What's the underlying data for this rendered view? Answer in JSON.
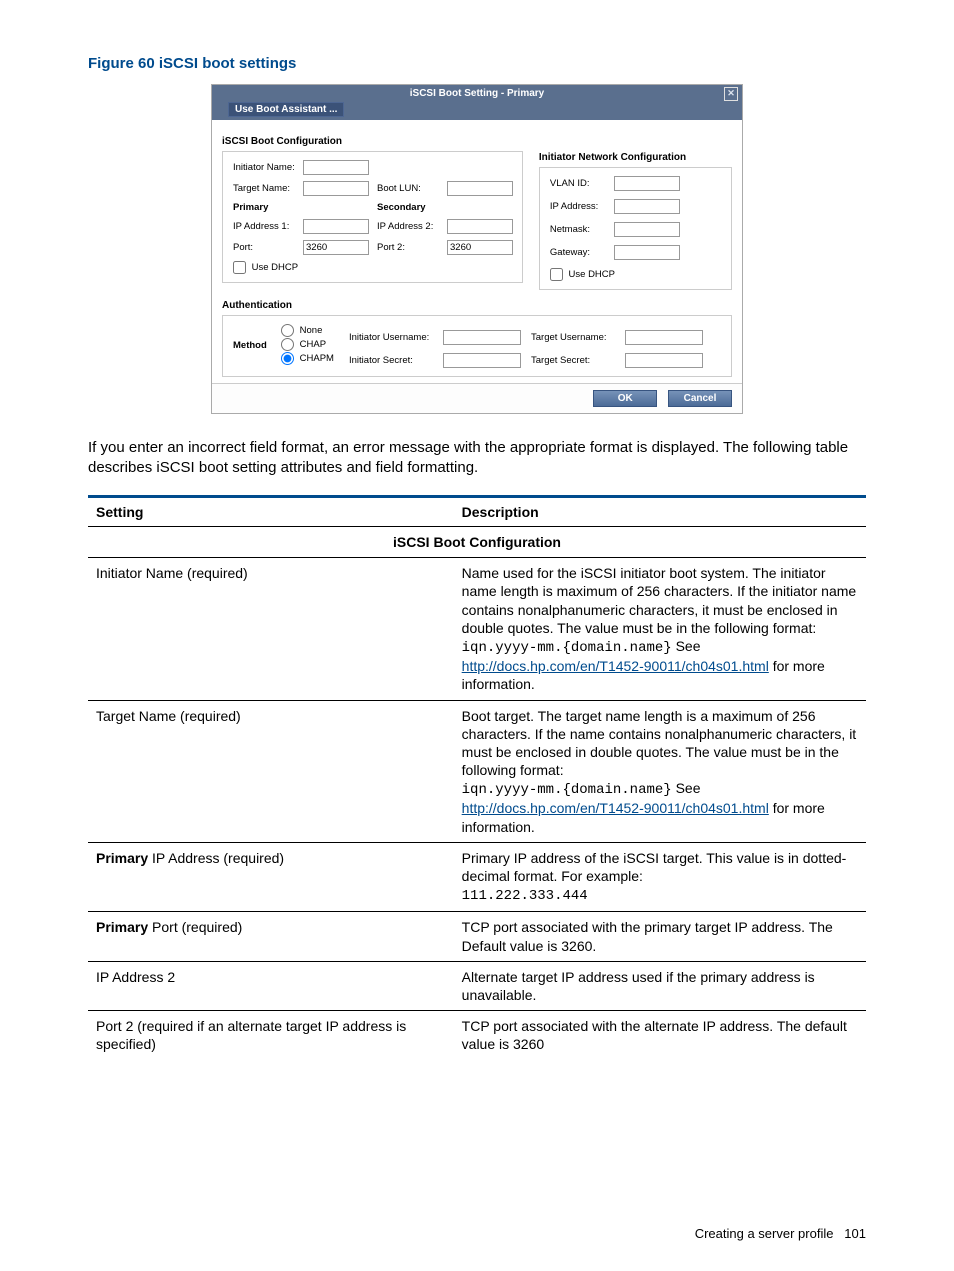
{
  "figure_caption": "Figure 60 iSCSI boot settings",
  "dialog": {
    "title": "iSCSI Boot Setting - Primary",
    "close_glyph": "✕",
    "boot_assistant_label": "Use Boot Assistant ...",
    "sections": {
      "boot_config": "iSCSI Boot Configuration",
      "net_config": "Initiator Network Configuration",
      "auth": "Authentication"
    },
    "labels": {
      "initiator_name": "Initiator Name:",
      "target_name": "Target Name:",
      "boot_lun": "Boot LUN:",
      "primary": "Primary",
      "secondary": "Secondary",
      "ip1": "IP Address 1:",
      "ip2": "IP Address 2:",
      "port": "Port:",
      "port2": "Port 2:",
      "use_dhcp": "Use DHCP",
      "vlan": "VLAN ID:",
      "ipaddr": "IP Address:",
      "netmask": "Netmask:",
      "gateway": "Gateway:",
      "method": "Method",
      "none": "None",
      "chap": "CHAP",
      "chapm": "CHAPM",
      "init_user": "Initiator Username:",
      "init_secret": "Initiator Secret:",
      "tgt_user": "Target Username:",
      "tgt_secret": "Target Secret:"
    },
    "values": {
      "port": "3260",
      "port2": "3260"
    },
    "buttons": {
      "ok": "OK",
      "cancel": "Cancel"
    }
  },
  "paragraph": "If you enter an incorrect field format, an error message with the appropriate format is displayed. The following table describes iSCSI boot setting attributes and field formatting.",
  "table": {
    "headers": {
      "setting": "Setting",
      "description": "Description"
    },
    "section_head": "iSCSI Boot Configuration",
    "rows": [
      {
        "setting_html": "Initiator Name (required)",
        "desc_html": "Name used for the iSCSI initiator boot system. The initiator name length is maximum of 256 characters. If the initiator name contains nonalphanumeric characters, it must be enclosed in double quotes. The value must be in the following format:<br><code class='mono'>iqn.yyyy-mm.{domain.name}</code> See <a class='link' href='#' data-interactable='true' data-name='doc-link-1'>http://docs.hp.com/en/T1452-90011/ch04s01.html</a> for more information."
      },
      {
        "setting_html": "Target Name (required)",
        "desc_html": "Boot target. The target name length is a maximum of 256 characters. If the name contains nonalphanumeric characters, it must be enclosed in double quotes. The value must be in the following format:<br><code class='mono'>iqn.yyyy-mm.{domain.name}</code> See <a class='link' href='#' data-interactable='true' data-name='doc-link-2'>http://docs.hp.com/en/T1452-90011/ch04s01.html</a> for more information."
      },
      {
        "setting_html": "<b>Primary</b> IP Address (required)",
        "desc_html": "Primary IP address of the iSCSI target. This value is in dotted-decimal format. For example:<br><code class='mono'>111.222.333.444</code>"
      },
      {
        "setting_html": "<b>Primary</b> Port (required)",
        "desc_html": "TCP port associated with the primary target IP address. The Default value is 3260."
      },
      {
        "setting_html": "IP Address 2",
        "desc_html": "Alternate target IP address used if the primary address is unavailable."
      },
      {
        "setting_html": "Port 2 (required if an alternate target IP address is specified)",
        "desc_html": "TCP port associated with the alternate IP address. The default value is 3260"
      }
    ]
  },
  "footer": {
    "text": "Creating a server profile",
    "page": "101"
  }
}
